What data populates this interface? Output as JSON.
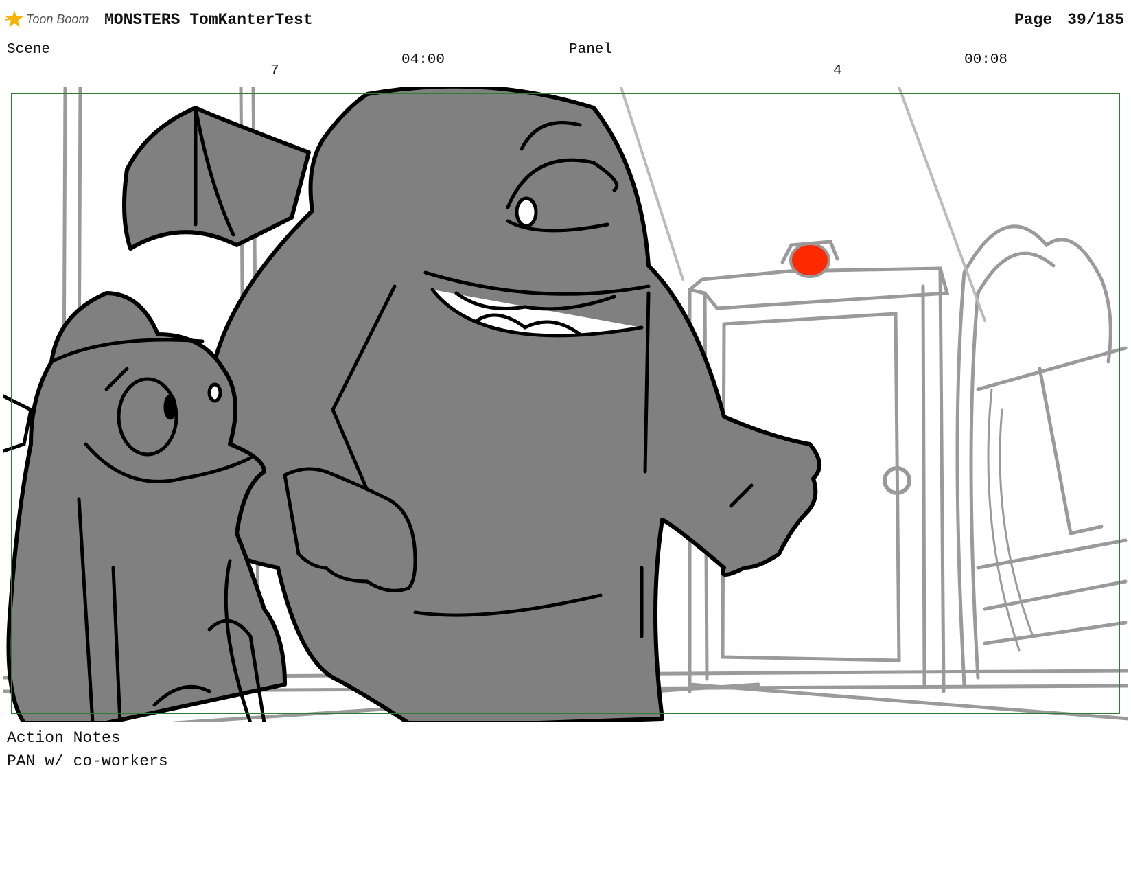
{
  "header": {
    "brand": "Toon Boom",
    "project_title": "MONSTERS TomKanterTest",
    "page_label": "Page",
    "page_number": "39/185"
  },
  "scene": {
    "label": "Scene",
    "number": "7",
    "duration": "04:00"
  },
  "panel": {
    "label": "Panel",
    "number": "4",
    "duration": "00:08"
  },
  "notes": {
    "label": "Action Notes",
    "text": "PAN w/ co-workers"
  },
  "colors": {
    "safe_frame": "#2e7d32",
    "monster_fill": "#808080",
    "door_light": "#ff2a00",
    "logo_star": "#f4b400"
  }
}
